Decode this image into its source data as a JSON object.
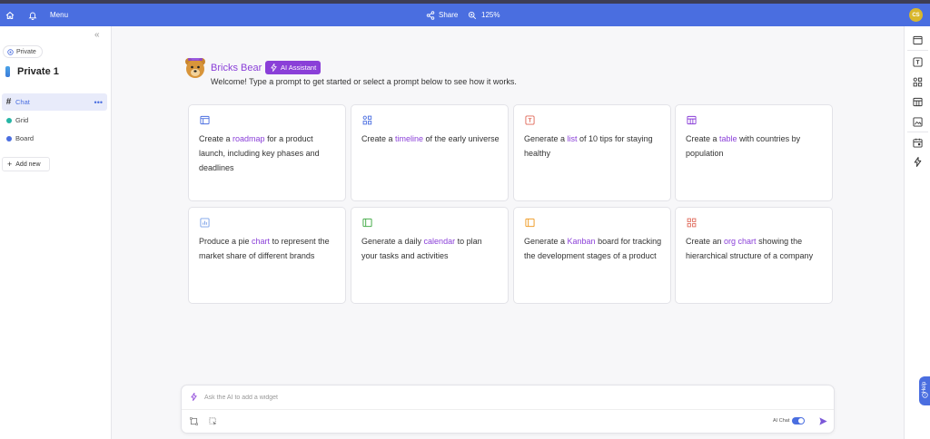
{
  "topbar": {
    "menu_label": "Menu",
    "share_label": "Share",
    "zoom_label": "125%",
    "user_initials": "CS",
    "accent_color": "#4a6ee0"
  },
  "sidebar": {
    "private_pill": "Private",
    "workspace_title": "Private 1",
    "items": [
      {
        "label": "Chat",
        "icon": "hash-icon",
        "active": true
      },
      {
        "label": "Grid",
        "icon": "teal-dot",
        "color": "#26b5a5"
      },
      {
        "label": "Board",
        "icon": "blue-dot",
        "color": "#4a6ee0"
      }
    ],
    "add_new_label": "Add new"
  },
  "header": {
    "bot_name": "Bricks Bear",
    "badge_label": "AI Assistant",
    "welcome_text": "Welcome! Type a prompt to get started or select a prompt below to see how it works."
  },
  "prompts": [
    {
      "pre": "Create a ",
      "kw": "roadmap",
      "post": " for a product launch, including key phases and deadlines",
      "icon": "roadmap-icon",
      "color": "#4a6ee0"
    },
    {
      "pre": "Create a ",
      "kw": "timeline",
      "post": " of the early universe",
      "icon": "timeline-icon",
      "color": "#4a6ee0"
    },
    {
      "pre": "Generate a ",
      "kw": "list",
      "post": " of 10 tips for staying healthy",
      "icon": "list-icon",
      "color": "#e06a5a"
    },
    {
      "pre": "Create a ",
      "kw": "table",
      "post": " with countries by population",
      "icon": "table-icon",
      "color": "#8a3fd8"
    },
    {
      "pre": "Produce a pie ",
      "kw": "chart",
      "post": " to represent the market share of different brands",
      "icon": "chart-icon",
      "color": "#7aa0e8"
    },
    {
      "pre": "Generate a daily ",
      "kw": "calendar",
      "post": " to plan your tasks and activities",
      "icon": "calendar-icon",
      "color": "#4caf50"
    },
    {
      "pre": "Generate a ",
      "kw": "Kanban",
      "post": " board for tracking the development stages of a product",
      "icon": "kanban-icon",
      "color": "#f0a030"
    },
    {
      "pre": "Create an ",
      "kw": "org chart",
      "post": " showing the hierarchical structure of a company",
      "icon": "org-chart-icon",
      "color": "#e06a5a"
    }
  ],
  "chat": {
    "placeholder": "Ask the AI to add a widget",
    "ai_chat_label": "AI Chat"
  },
  "help_label": "Help"
}
